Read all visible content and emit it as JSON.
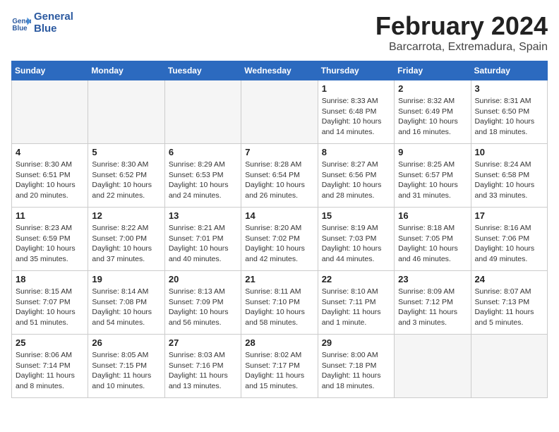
{
  "header": {
    "logo_text_general": "General",
    "logo_text_blue": "Blue",
    "main_title": "February 2024",
    "sub_title": "Barcarrota, Extremadura, Spain"
  },
  "calendar": {
    "days_of_week": [
      "Sunday",
      "Monday",
      "Tuesday",
      "Wednesday",
      "Thursday",
      "Friday",
      "Saturday"
    ],
    "weeks": [
      [
        {
          "day": "",
          "info": ""
        },
        {
          "day": "",
          "info": ""
        },
        {
          "day": "",
          "info": ""
        },
        {
          "day": "",
          "info": ""
        },
        {
          "day": "1",
          "info": "Sunrise: 8:33 AM\nSunset: 6:48 PM\nDaylight: 10 hours and 14 minutes."
        },
        {
          "day": "2",
          "info": "Sunrise: 8:32 AM\nSunset: 6:49 PM\nDaylight: 10 hours and 16 minutes."
        },
        {
          "day": "3",
          "info": "Sunrise: 8:31 AM\nSunset: 6:50 PM\nDaylight: 10 hours and 18 minutes."
        }
      ],
      [
        {
          "day": "4",
          "info": "Sunrise: 8:30 AM\nSunset: 6:51 PM\nDaylight: 10 hours and 20 minutes."
        },
        {
          "day": "5",
          "info": "Sunrise: 8:30 AM\nSunset: 6:52 PM\nDaylight: 10 hours and 22 minutes."
        },
        {
          "day": "6",
          "info": "Sunrise: 8:29 AM\nSunset: 6:53 PM\nDaylight: 10 hours and 24 minutes."
        },
        {
          "day": "7",
          "info": "Sunrise: 8:28 AM\nSunset: 6:54 PM\nDaylight: 10 hours and 26 minutes."
        },
        {
          "day": "8",
          "info": "Sunrise: 8:27 AM\nSunset: 6:56 PM\nDaylight: 10 hours and 28 minutes."
        },
        {
          "day": "9",
          "info": "Sunrise: 8:25 AM\nSunset: 6:57 PM\nDaylight: 10 hours and 31 minutes."
        },
        {
          "day": "10",
          "info": "Sunrise: 8:24 AM\nSunset: 6:58 PM\nDaylight: 10 hours and 33 minutes."
        }
      ],
      [
        {
          "day": "11",
          "info": "Sunrise: 8:23 AM\nSunset: 6:59 PM\nDaylight: 10 hours and 35 minutes."
        },
        {
          "day": "12",
          "info": "Sunrise: 8:22 AM\nSunset: 7:00 PM\nDaylight: 10 hours and 37 minutes."
        },
        {
          "day": "13",
          "info": "Sunrise: 8:21 AM\nSunset: 7:01 PM\nDaylight: 10 hours and 40 minutes."
        },
        {
          "day": "14",
          "info": "Sunrise: 8:20 AM\nSunset: 7:02 PM\nDaylight: 10 hours and 42 minutes."
        },
        {
          "day": "15",
          "info": "Sunrise: 8:19 AM\nSunset: 7:03 PM\nDaylight: 10 hours and 44 minutes."
        },
        {
          "day": "16",
          "info": "Sunrise: 8:18 AM\nSunset: 7:05 PM\nDaylight: 10 hours and 46 minutes."
        },
        {
          "day": "17",
          "info": "Sunrise: 8:16 AM\nSunset: 7:06 PM\nDaylight: 10 hours and 49 minutes."
        }
      ],
      [
        {
          "day": "18",
          "info": "Sunrise: 8:15 AM\nSunset: 7:07 PM\nDaylight: 10 hours and 51 minutes."
        },
        {
          "day": "19",
          "info": "Sunrise: 8:14 AM\nSunset: 7:08 PM\nDaylight: 10 hours and 54 minutes."
        },
        {
          "day": "20",
          "info": "Sunrise: 8:13 AM\nSunset: 7:09 PM\nDaylight: 10 hours and 56 minutes."
        },
        {
          "day": "21",
          "info": "Sunrise: 8:11 AM\nSunset: 7:10 PM\nDaylight: 10 hours and 58 minutes."
        },
        {
          "day": "22",
          "info": "Sunrise: 8:10 AM\nSunset: 7:11 PM\nDaylight: 11 hours and 1 minute."
        },
        {
          "day": "23",
          "info": "Sunrise: 8:09 AM\nSunset: 7:12 PM\nDaylight: 11 hours and 3 minutes."
        },
        {
          "day": "24",
          "info": "Sunrise: 8:07 AM\nSunset: 7:13 PM\nDaylight: 11 hours and 5 minutes."
        }
      ],
      [
        {
          "day": "25",
          "info": "Sunrise: 8:06 AM\nSunset: 7:14 PM\nDaylight: 11 hours and 8 minutes."
        },
        {
          "day": "26",
          "info": "Sunrise: 8:05 AM\nSunset: 7:15 PM\nDaylight: 11 hours and 10 minutes."
        },
        {
          "day": "27",
          "info": "Sunrise: 8:03 AM\nSunset: 7:16 PM\nDaylight: 11 hours and 13 minutes."
        },
        {
          "day": "28",
          "info": "Sunrise: 8:02 AM\nSunset: 7:17 PM\nDaylight: 11 hours and 15 minutes."
        },
        {
          "day": "29",
          "info": "Sunrise: 8:00 AM\nSunset: 7:18 PM\nDaylight: 11 hours and 18 minutes."
        },
        {
          "day": "",
          "info": ""
        },
        {
          "day": "",
          "info": ""
        }
      ]
    ]
  }
}
